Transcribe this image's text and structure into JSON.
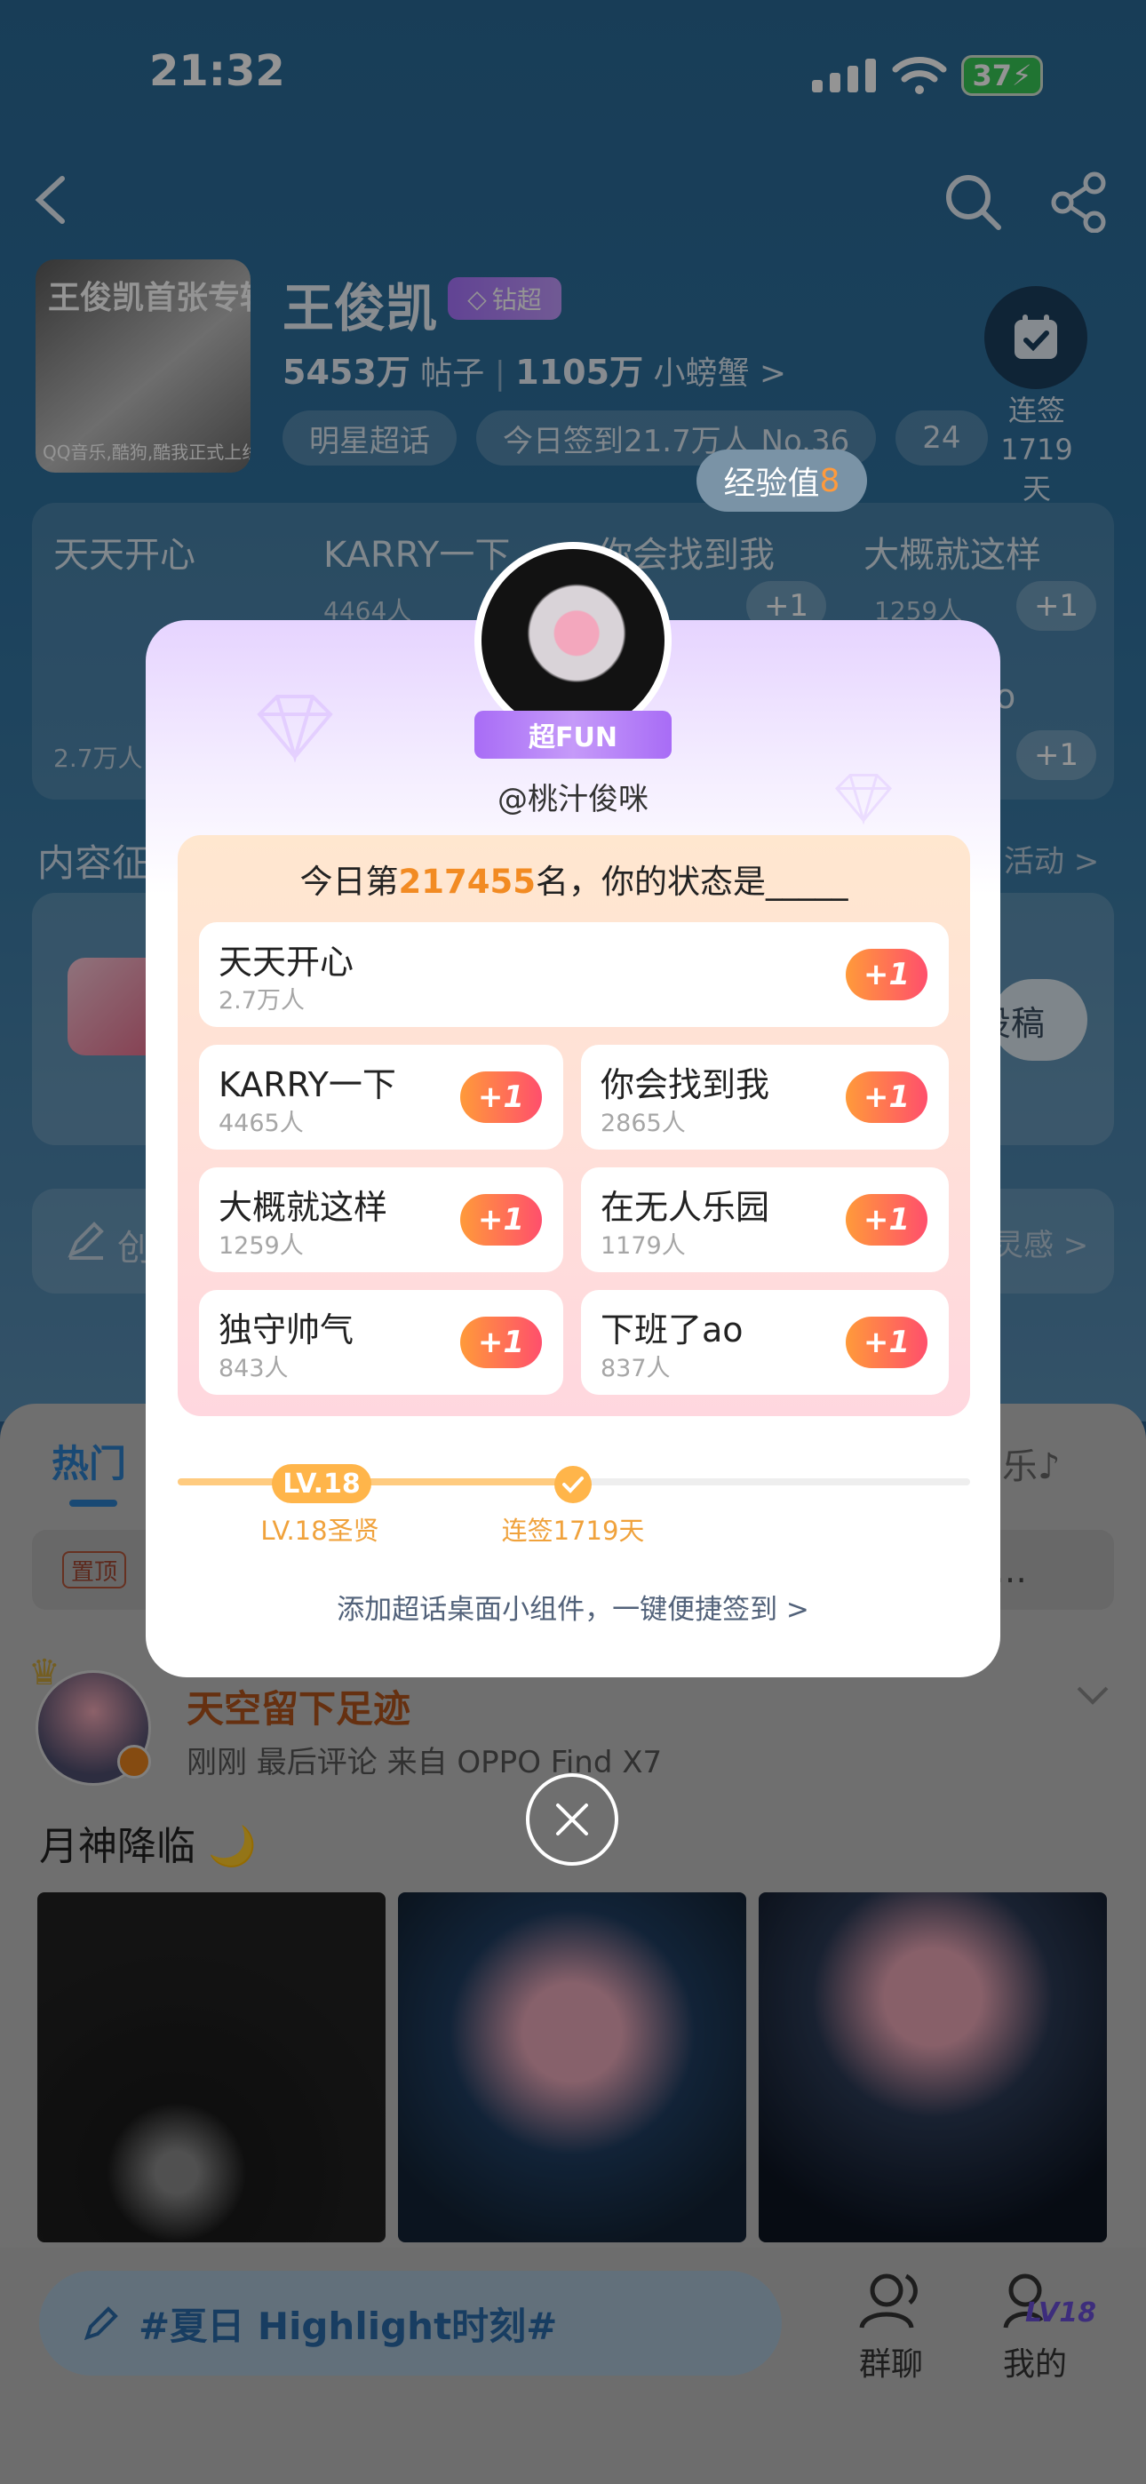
{
  "status": {
    "time": "21:32",
    "battery": "37"
  },
  "header": {
    "album_text": "王俊凯首张专辑",
    "album_sub": "QQ音乐,酷狗,酷我正式上线",
    "star_name": "王俊凯",
    "badge": "钻超",
    "posts_count": "5453万",
    "posts_label": "帖子",
    "fans_count": "1105万",
    "fans_label": "小螃蟹 >",
    "chips": [
      "明星超话",
      "今日签到21.7万人 No.36",
      "24"
    ],
    "checkin_label": "连签",
    "checkin_days": "1719天"
  },
  "background": {
    "grid": [
      {
        "label": "天天开心",
        "sub": "2.7万人"
      },
      {
        "label": "KARRY一下",
        "sub": "4464人"
      },
      {
        "label": "你会找到我",
        "sub": ""
      },
      {
        "label": "大概就这样",
        "sub": "1259人"
      }
    ],
    "section_label": "内容征",
    "activity_link": "活动 >",
    "post_button": "投稿",
    "inspire": "灵感 >",
    "create_prefix": "创",
    "plus": "+1",
    "row2_right": "o"
  },
  "feed": {
    "tab_hot": "热门",
    "tab_music": "乐♪",
    "pin_tag": "置顶",
    "pin_text": "…",
    "username": "天空留下足迹",
    "meta": "刚刚  最后评论  来自 OPPO Find X7",
    "post_title": "月神降临 🌙",
    "compose": "#夏日 Highlight时刻#",
    "group_chat": "群聊",
    "mine": "我的",
    "mine_level": "LV18"
  },
  "popup": {
    "exp_label": "经验值",
    "exp_value": "8",
    "role_badge": "超FUN",
    "handle": "@桃汁俊咪",
    "rank_prefix": "今日第",
    "rank_number": "217455",
    "rank_suffix": "名，你的状态是_____",
    "plus_label": "+1",
    "options": [
      {
        "label": "天天开心",
        "count": "2.7万人"
      },
      {
        "label": "KARRY一下",
        "count": "4465人"
      },
      {
        "label": "你会找到我",
        "count": "2865人"
      },
      {
        "label": "大概就这样",
        "count": "1259人"
      },
      {
        "label": "在无人乐园",
        "count": "1179人"
      },
      {
        "label": "独守帅气",
        "count": "843人"
      },
      {
        "label": "下班了ao",
        "count": "837人"
      }
    ],
    "level_pill": "LV.18",
    "level_label": "LV.18圣贤",
    "streak_label": "连签1719天",
    "widget_link": "添加超话桌面小组件，一键便捷签到 >"
  },
  "colors": {
    "accent": "#f28b23",
    "blue": "#2c7ec8",
    "plus_start": "#ff9a3a",
    "plus_end": "#ff4f6c"
  }
}
